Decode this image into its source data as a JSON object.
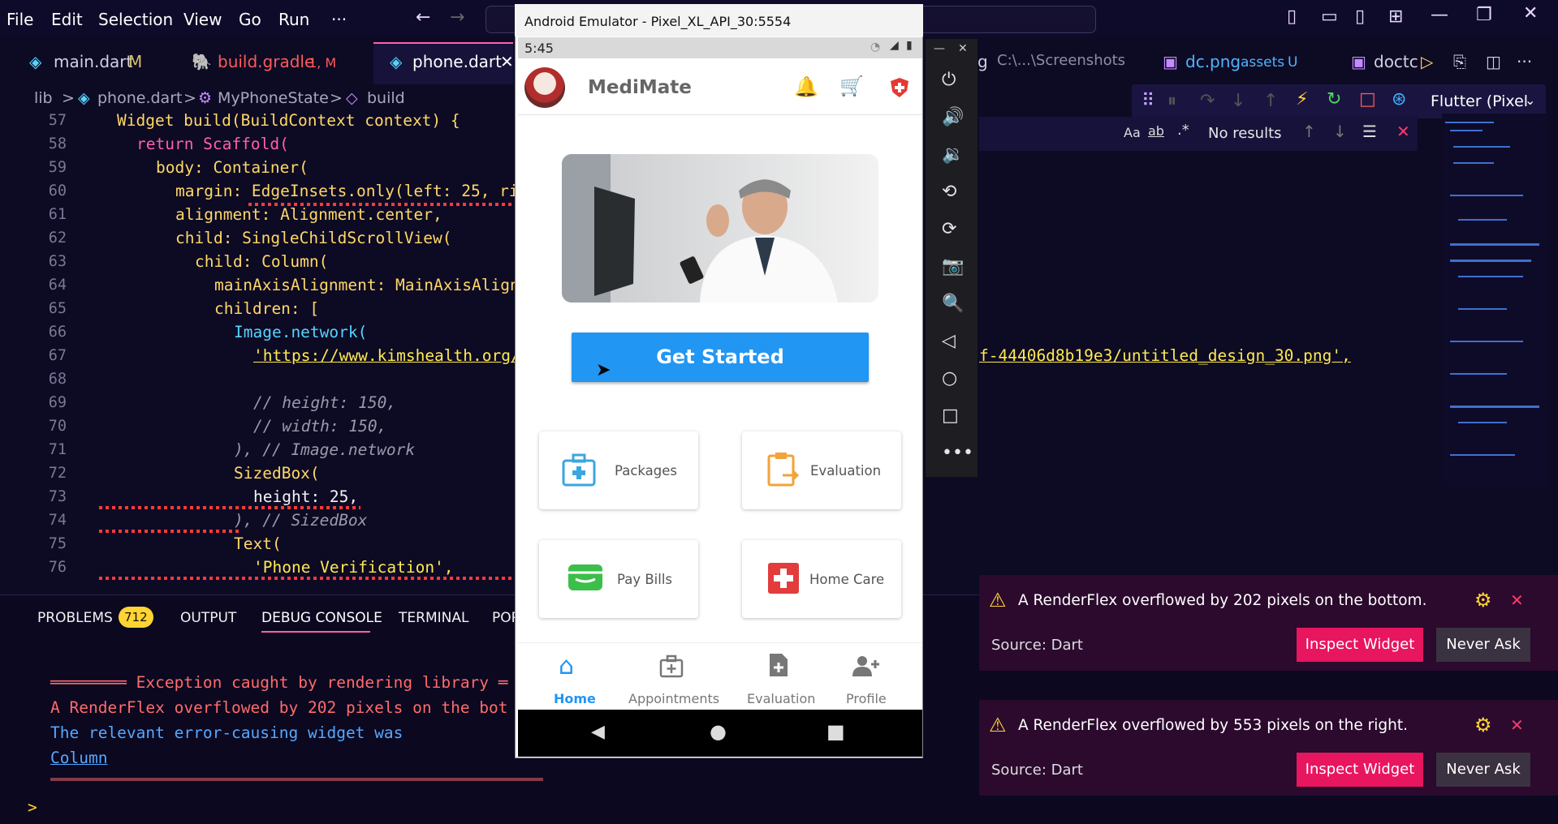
{
  "menubar": {
    "items": [
      "File",
      "Edit",
      "Selection",
      "View",
      "Go",
      "Run",
      "···"
    ],
    "window_controls": [
      "minimize-icon",
      "restore-icon",
      "close-icon"
    ]
  },
  "tabs": [
    {
      "label": "main.dart",
      "badge": "M",
      "color": "#d0d0e0"
    },
    {
      "label": "build.gradle",
      "badge": "1, M",
      "color": "#ff5a5a"
    },
    {
      "label": "phone.dart",
      "badge": "",
      "color": "#ffffff",
      "active": true
    },
    {
      "label": "g",
      "path": "C:\\...\\Screenshots"
    },
    {
      "label": "dc.png",
      "path": "assets",
      "badge": "U"
    },
    {
      "label": "doctc"
    }
  ],
  "breadcrumb": [
    "lib",
    ">",
    "phone.dart",
    ">",
    "MyPhoneState",
    ">",
    "build"
  ],
  "debug_toolbar": {
    "target": "Flutter (Pixel"
  },
  "find": {
    "status": "No results"
  },
  "code": {
    "line_numbers": [
      "57",
      "58",
      "59",
      "60",
      "61",
      "62",
      "63",
      "64",
      "65",
      "66",
      "67",
      "68",
      "69",
      "70",
      "71",
      "72",
      "73",
      "74",
      "75",
      "76"
    ],
    "l57": "Widget build(BuildContext context) {",
    "l58": "return Scaffold(",
    "l59": "body: Container(",
    "l60": "margin: EdgeInsets.only(left: 25, ri",
    "l61": "alignment: Alignment.center,",
    "l62": "child: SingleChildScrollView(",
    "l63": "child: Column(",
    "l64": "mainAxisAlignment: MainAxisAlign",
    "l65": "children: [",
    "l66": "Image.network(",
    "l67a": "'https://www.kimshealth.org/",
    "l67b": "f-44406d8b19e3/untitled_design_30.png',",
    "l69": "// height: 150,",
    "l70": "// width: 150,",
    "l71": "), // Image.network",
    "l72": "SizedBox(",
    "l73": "height: 25,",
    "l74": "), // SizedBox",
    "l75": "Text(",
    "l76": "'Phone Verification',"
  },
  "panel": {
    "tabs": [
      "PROBLEMS",
      "OUTPUT",
      "DEBUG CONSOLE",
      "TERMINAL",
      "POR"
    ],
    "problems_count": "712",
    "console": {
      "line1": "════════ Exception caught by rendering library ═",
      "line2": "A RenderFlex overflowed by 202 pixels on the bot",
      "line3": "The relevant error-causing widget was",
      "line4": "Column",
      "line5": "════════════════════════════════════════════════════════════════════════════════════"
    },
    "prompt": ">"
  },
  "emulator": {
    "title": "Android Emulator - Pixel_XL_API_30:5554",
    "time": "5:45",
    "app": {
      "name": "MediMate",
      "cta": "Get Started",
      "cards": [
        {
          "label": "Packages",
          "icon": "medical-kit-icon",
          "color": "#3aa6e0"
        },
        {
          "label": "Evaluation",
          "icon": "clipboard-icon",
          "color": "#f2a33a"
        },
        {
          "label": "Pay Bills",
          "icon": "wallet-icon",
          "color": "#3cbf4a"
        },
        {
          "label": "Home Care",
          "icon": "first-aid-icon",
          "color": "#e23c3c"
        }
      ],
      "nav": [
        {
          "label": "Home",
          "active": true
        },
        {
          "label": "Appointments"
        },
        {
          "label": "Evaluation"
        },
        {
          "label": "Profile"
        }
      ]
    }
  },
  "notifications": [
    {
      "message": "A RenderFlex overflowed by 202 pixels on the bottom.",
      "source": "Source: Dart",
      "primary": "Inspect Widget",
      "secondary": "Never Ask"
    },
    {
      "message": "A RenderFlex overflowed by 553 pixels on the right.",
      "source": "Source: Dart",
      "primary": "Inspect Widget",
      "secondary": "Never Ask"
    }
  ],
  "colors": {
    "accent": "#e8155f",
    "brand_blue": "#2196f3",
    "editor_bg": "#0d0a24"
  }
}
